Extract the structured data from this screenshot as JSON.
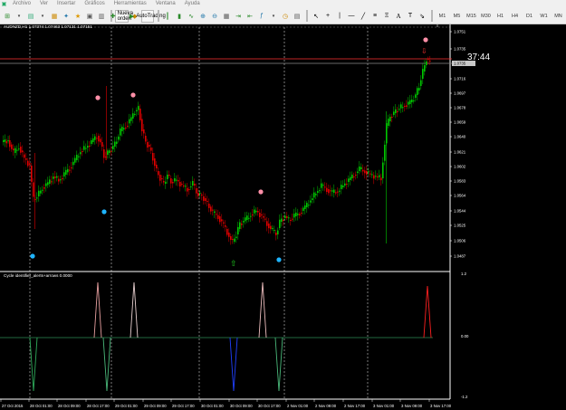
{
  "menu": {
    "items": [
      "Archivo",
      "Ver",
      "Insertar",
      "Gráficos",
      "Herramientas",
      "Ventana",
      "Ayuda"
    ]
  },
  "toolbar": {
    "new_order_label": "Nueva orden",
    "autotrading_label": "AutoTrading",
    "timeframes": [
      "M1",
      "M5",
      "M15",
      "M30",
      "H1",
      "H4",
      "D1",
      "W1",
      "MN"
    ]
  },
  "chart": {
    "header": "AUDNZD,H1  1.07374 1.07463 1.07131 1.07151",
    "countdown": "37:44",
    "price_ticks": [
      "1.0751",
      "1.0735",
      "1.0716",
      "1.0697",
      "1.0678",
      "1.0659",
      "1.0640",
      "1.0621",
      "1.0602",
      "1.0583",
      "1.0564",
      "1.0544",
      "1.0525",
      "1.0506",
      "1.0487"
    ],
    "current_price_tag": "1.0735",
    "time_labels": [
      "27 Oct 2015",
      "28 Oct 01:00",
      "28 Oct 09:00",
      "28 Oct 17:00",
      "29 Oct 01:00",
      "29 Oct 09:00",
      "29 Oct 17:00",
      "30 Oct 01:00",
      "30 Oct 09:00",
      "30 Oct 17:00",
      "2 Nov 01:00",
      "2 Nov 09:00",
      "2 Nov 17:00",
      "3 Nov 01:00",
      "3 Nov 09:00",
      "3 Nov 17:00"
    ],
    "colors": {
      "bull": "#00c800",
      "bear": "#e00000",
      "pink_dot": "#ff8fa8",
      "blue_dot": "#1eb4ff",
      "grid": "#ffffff"
    }
  },
  "indicator": {
    "label": "Cycle identifier_alerts+arrows 0.0000",
    "ticks": [
      "1.2",
      "0.00",
      "-1.2"
    ]
  }
}
